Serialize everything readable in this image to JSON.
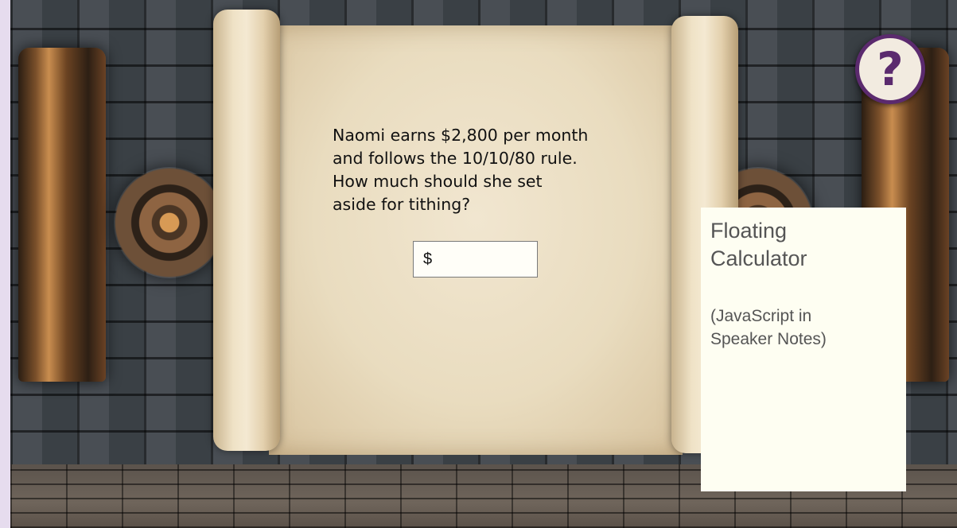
{
  "question": {
    "lines": [
      "Naomi earns $2,800 per month",
      "and follows the 10/10/80 rule.",
      "How much should she set",
      "aside for tithing?"
    ]
  },
  "answer": {
    "prefix": "$",
    "value": "",
    "placeholder": ""
  },
  "calculator": {
    "title_line1": "Floating",
    "title_line2": "Calculator",
    "note_line1": "(JavaScript in",
    "note_line2": "Speaker Notes)"
  },
  "help_button": {
    "icon": "question-mark-icon",
    "label": "?",
    "color": "#5b2a6e"
  },
  "colors": {
    "paper": "#efe4cc",
    "help_accent": "#5b2a6e",
    "calculator_bg": "#fefef2"
  }
}
